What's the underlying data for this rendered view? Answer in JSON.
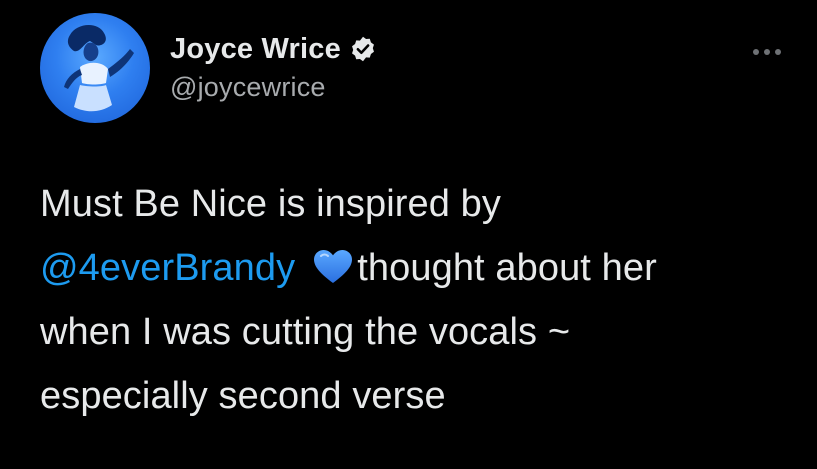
{
  "tweet": {
    "author": {
      "display_name": "Joyce Wrice",
      "handle": "@joycewrice",
      "verified": true
    },
    "more_icon": "ellipsis-icon",
    "body": {
      "part1": "Must Be Nice is inspired by",
      "mention": "@4everBrandy",
      "emoji": "blue-heart-icon",
      "part2": "thought about her",
      "part3": "when I was cutting the vocals ~",
      "part4": "especially second verse"
    }
  },
  "colors": {
    "background": "#000000",
    "text": "#e7e9ea",
    "secondary_text": "#a8abae",
    "link": "#1d9bf0",
    "heart": "#3a8dff"
  }
}
